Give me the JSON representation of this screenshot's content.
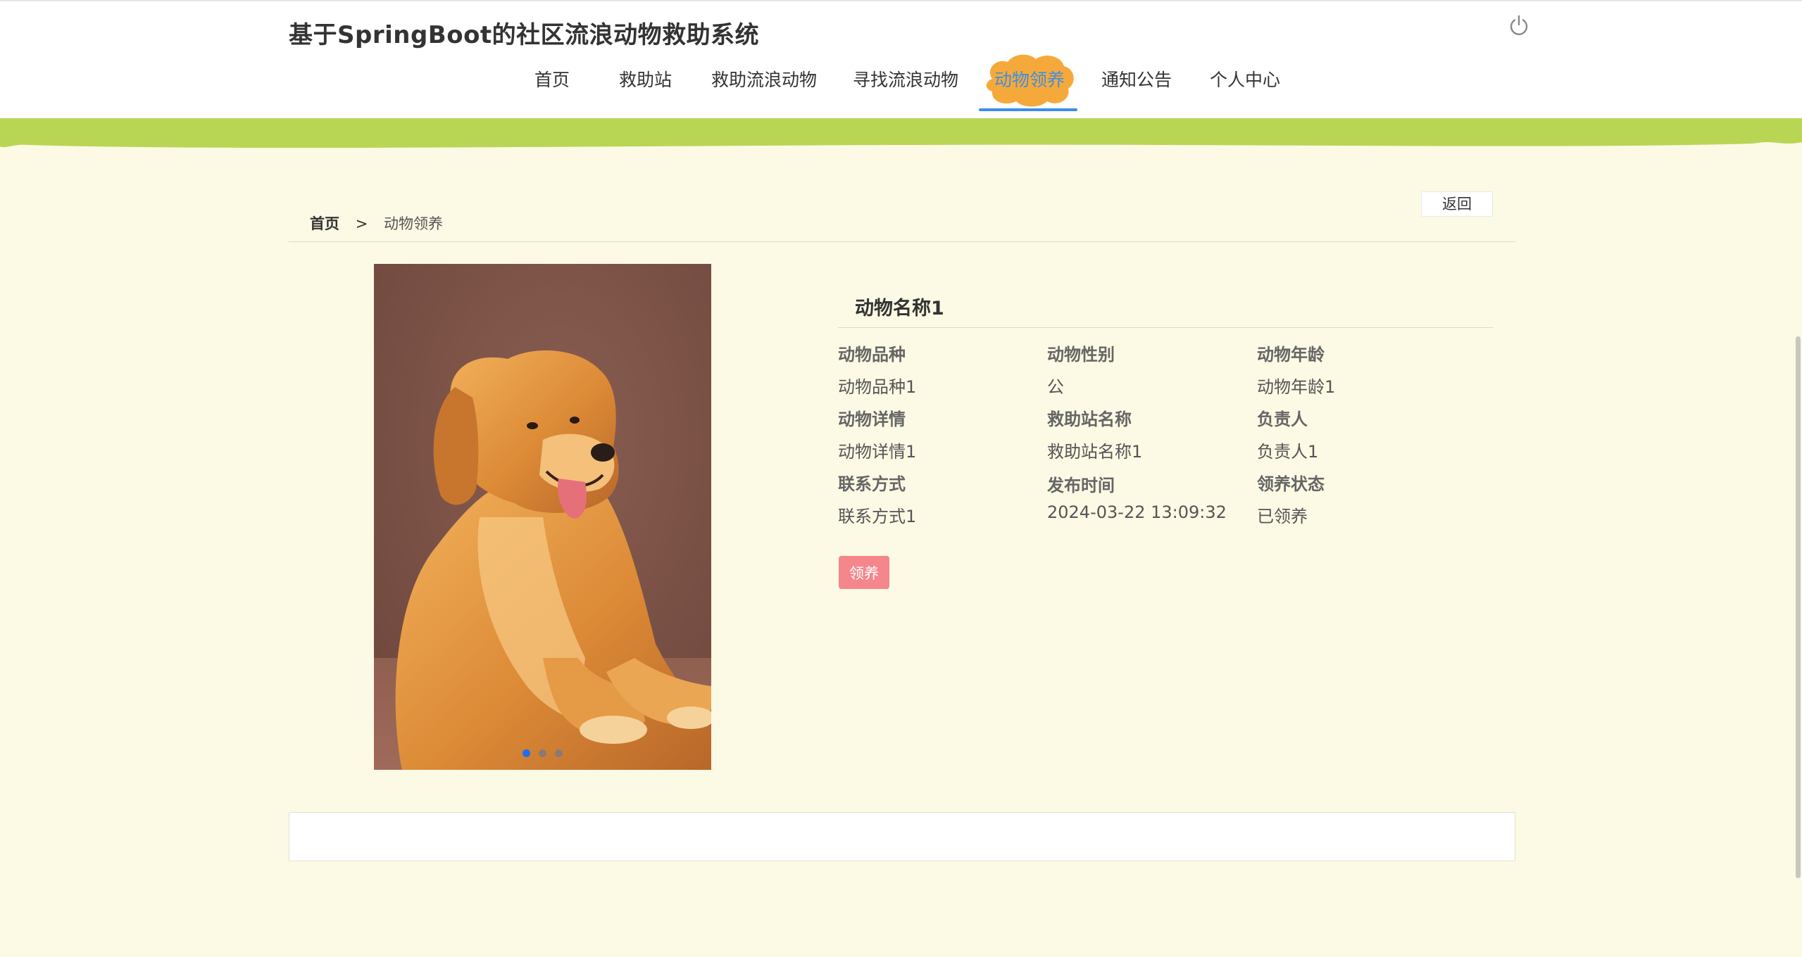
{
  "header": {
    "title": "基于SpringBoot的社区流浪动物救助系统",
    "power_icon": "power-icon"
  },
  "nav": {
    "items": [
      {
        "label": "首页"
      },
      {
        "label": "救助站"
      },
      {
        "label": "救助流浪动物"
      },
      {
        "label": "寻找流浪动物"
      },
      {
        "label": "动物领养",
        "active": true
      },
      {
        "label": "通知公告"
      },
      {
        "label": "个人中心"
      }
    ]
  },
  "breadcrumb": {
    "home": "首页",
    "separator": ">",
    "current": "动物领养"
  },
  "back_label": "返回",
  "carousel": {
    "slide_count": 3,
    "active_index": 0
  },
  "detail": {
    "name": "动物名称1",
    "fields": [
      {
        "label": "动物品种",
        "value": "动物品种1"
      },
      {
        "label": "动物性别",
        "value": "公"
      },
      {
        "label": "动物年龄",
        "value": "动物年龄1"
      },
      {
        "label": "动物详情",
        "value": "动物详情1"
      },
      {
        "label": "救助站名称",
        "value": "救助站名称1"
      },
      {
        "label": "负责人",
        "value": "负责人1"
      },
      {
        "label": "联系方式",
        "value": "联系方式1"
      },
      {
        "label": "发布时间",
        "value": "2024-03-22 13:09:32"
      },
      {
        "label": "领养状态",
        "value": "已领养"
      }
    ]
  },
  "adopt_label": "领养",
  "colors": {
    "background": "#fcf9e4",
    "wave_green": "#b8d654",
    "active_blob": "#f6a93b",
    "active_nav": "#3f8fe0",
    "adopt_button": "#f4868c"
  }
}
